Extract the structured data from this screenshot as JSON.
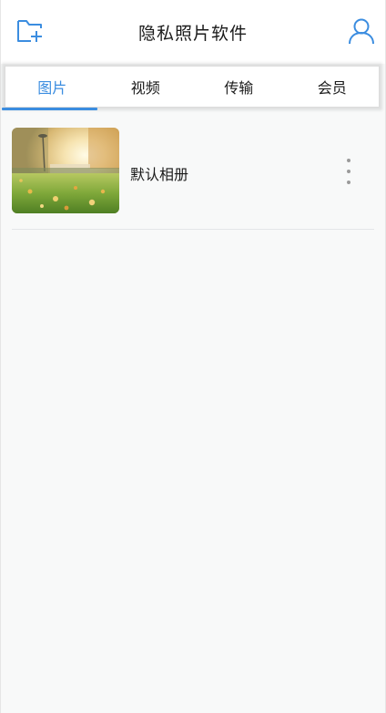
{
  "header": {
    "title": "隐私照片软件",
    "left_icon": "folder-add-icon",
    "right_icon": "user-icon",
    "accent_color": "#3b8de0"
  },
  "tabs": [
    {
      "label": "图片",
      "active": true
    },
    {
      "label": "视频",
      "active": false
    },
    {
      "label": "传输",
      "active": false
    },
    {
      "label": "会员",
      "active": false
    }
  ],
  "albums": [
    {
      "name": "默认相册",
      "thumbnail": "autumn-park-photo",
      "menu_icon": "more-vertical-icon"
    }
  ]
}
